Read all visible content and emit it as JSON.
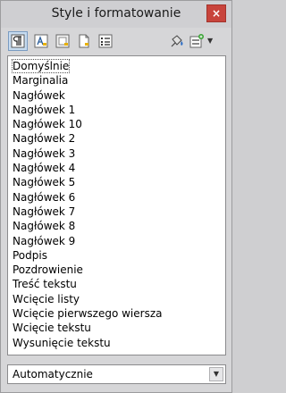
{
  "window": {
    "title": "Style i formatowanie",
    "close_glyph": "×"
  },
  "toolbar": {
    "buttons": [
      {
        "name": "paragraph-styles",
        "icon": "paragraph-styles-icon",
        "active": true
      },
      {
        "name": "character-styles",
        "icon": "character-styles-icon"
      },
      {
        "name": "frame-styles",
        "icon": "frame-styles-icon"
      },
      {
        "name": "page-styles",
        "icon": "page-styles-icon"
      },
      {
        "name": "list-styles",
        "icon": "list-styles-icon"
      },
      {
        "name": "fill-format-mode",
        "icon": "fill-format-icon"
      },
      {
        "name": "new-style-from-selection",
        "icon": "new-style-icon"
      }
    ]
  },
  "styles": [
    "Domyślnie",
    "Marginalia",
    "Nagłówek",
    "Nagłówek 1",
    "Nagłówek 10",
    "Nagłówek 2",
    "Nagłówek 3",
    "Nagłówek 4",
    "Nagłówek 5",
    "Nagłówek 6",
    "Nagłówek 7",
    "Nagłówek 8",
    "Nagłówek 9",
    "Podpis",
    "Pozdrowienie",
    "Treść tekstu",
    "Wcięcie listy",
    "Wcięcie pierwszego wiersza",
    "Wcięcie tekstu",
    "Wysunięcie tekstu"
  ],
  "selected_style": "Domyślnie",
  "filter": {
    "value": "Automatycznie"
  },
  "colors": {
    "close": "#c8443c",
    "selection_highlight": "#c7dbef"
  }
}
